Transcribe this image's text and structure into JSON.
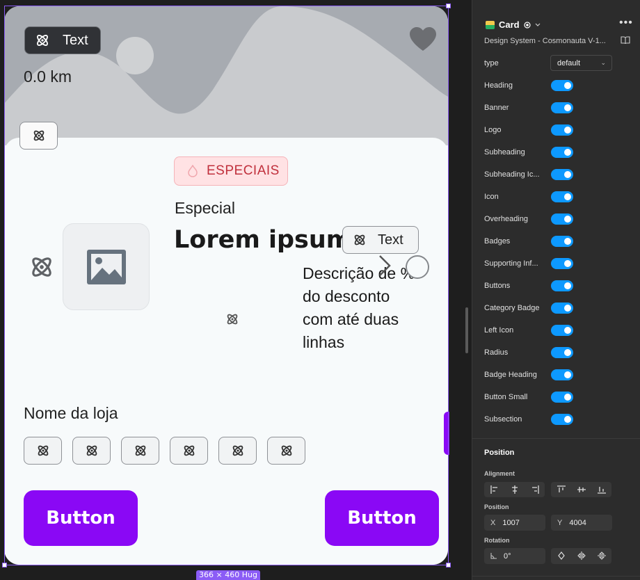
{
  "card": {
    "chip_text": "Text",
    "distance": "0.0 km",
    "badge": "ESPECIAIS",
    "overheading": "Especial",
    "heading": "Lorem ipsum",
    "heading_chip_text": "Text",
    "description": "Descrição de % do desconto com até duas linhas",
    "subheading": "Nome da loja",
    "button_left": "Button",
    "button_right": "Button",
    "size_tag": "366 × 460 Hug",
    "colors": {
      "accent": "#8a08f5",
      "badge_text": "#c0303c",
      "badge_bg": "#ffe2e4",
      "banner": "#a7abb1"
    }
  },
  "panel": {
    "component_name": "Card",
    "library": "Design System - Cosmonauta V-1...",
    "type_label": "type",
    "type_value": "default",
    "toggles": [
      "Heading",
      "Banner",
      "Logo",
      "Subheading",
      "Subheading Ic...",
      "Icon",
      "Overheading",
      "Badges",
      "Supporting Inf...",
      "Buttons",
      "Category Badge",
      "Left Icon",
      "Radius",
      "Badge Heading",
      "Button Small",
      "Subsection"
    ],
    "position_title": "Position",
    "alignment_label": "Alignment",
    "position_label": "Position",
    "x_key": "X",
    "x_value": "1007",
    "y_key": "Y",
    "y_value": "4004",
    "rotation_label": "Rotation",
    "rotation_value": "0°",
    "toggle_color": "#0d99ff"
  }
}
